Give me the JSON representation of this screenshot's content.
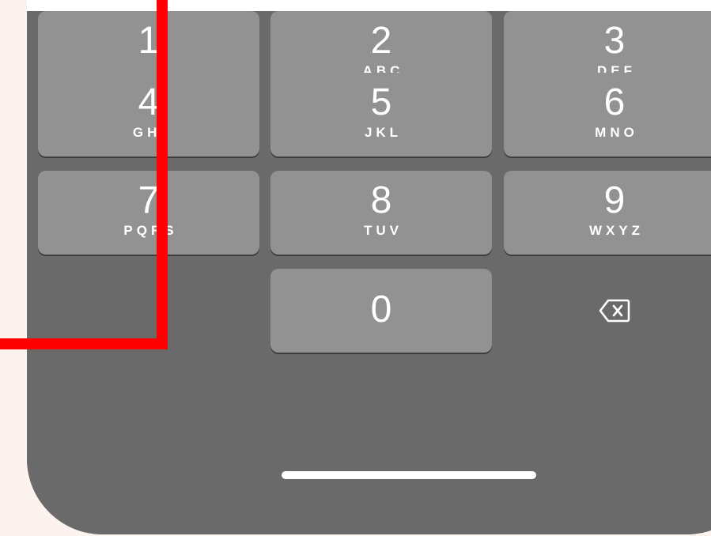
{
  "keypad": {
    "keys": [
      {
        "digit": "1",
        "letters": ""
      },
      {
        "digit": "2",
        "letters": "ABC"
      },
      {
        "digit": "3",
        "letters": "DEF"
      },
      {
        "digit": "4",
        "letters": "GHI"
      },
      {
        "digit": "5",
        "letters": "JKL"
      },
      {
        "digit": "6",
        "letters": "MNO"
      },
      {
        "digit": "7",
        "letters": "PQRS"
      },
      {
        "digit": "8",
        "letters": "TUV"
      },
      {
        "digit": "9",
        "letters": "WXYZ"
      },
      {
        "digit": "0",
        "letters": ""
      }
    ],
    "delete_icon": "delete-backspace-icon"
  },
  "colors": {
    "page_background": "#fdf3ee",
    "keypad_background": "#6a6a6a",
    "key_background": "#929292",
    "key_text": "#ffffff",
    "highlight": "#ff0000"
  }
}
